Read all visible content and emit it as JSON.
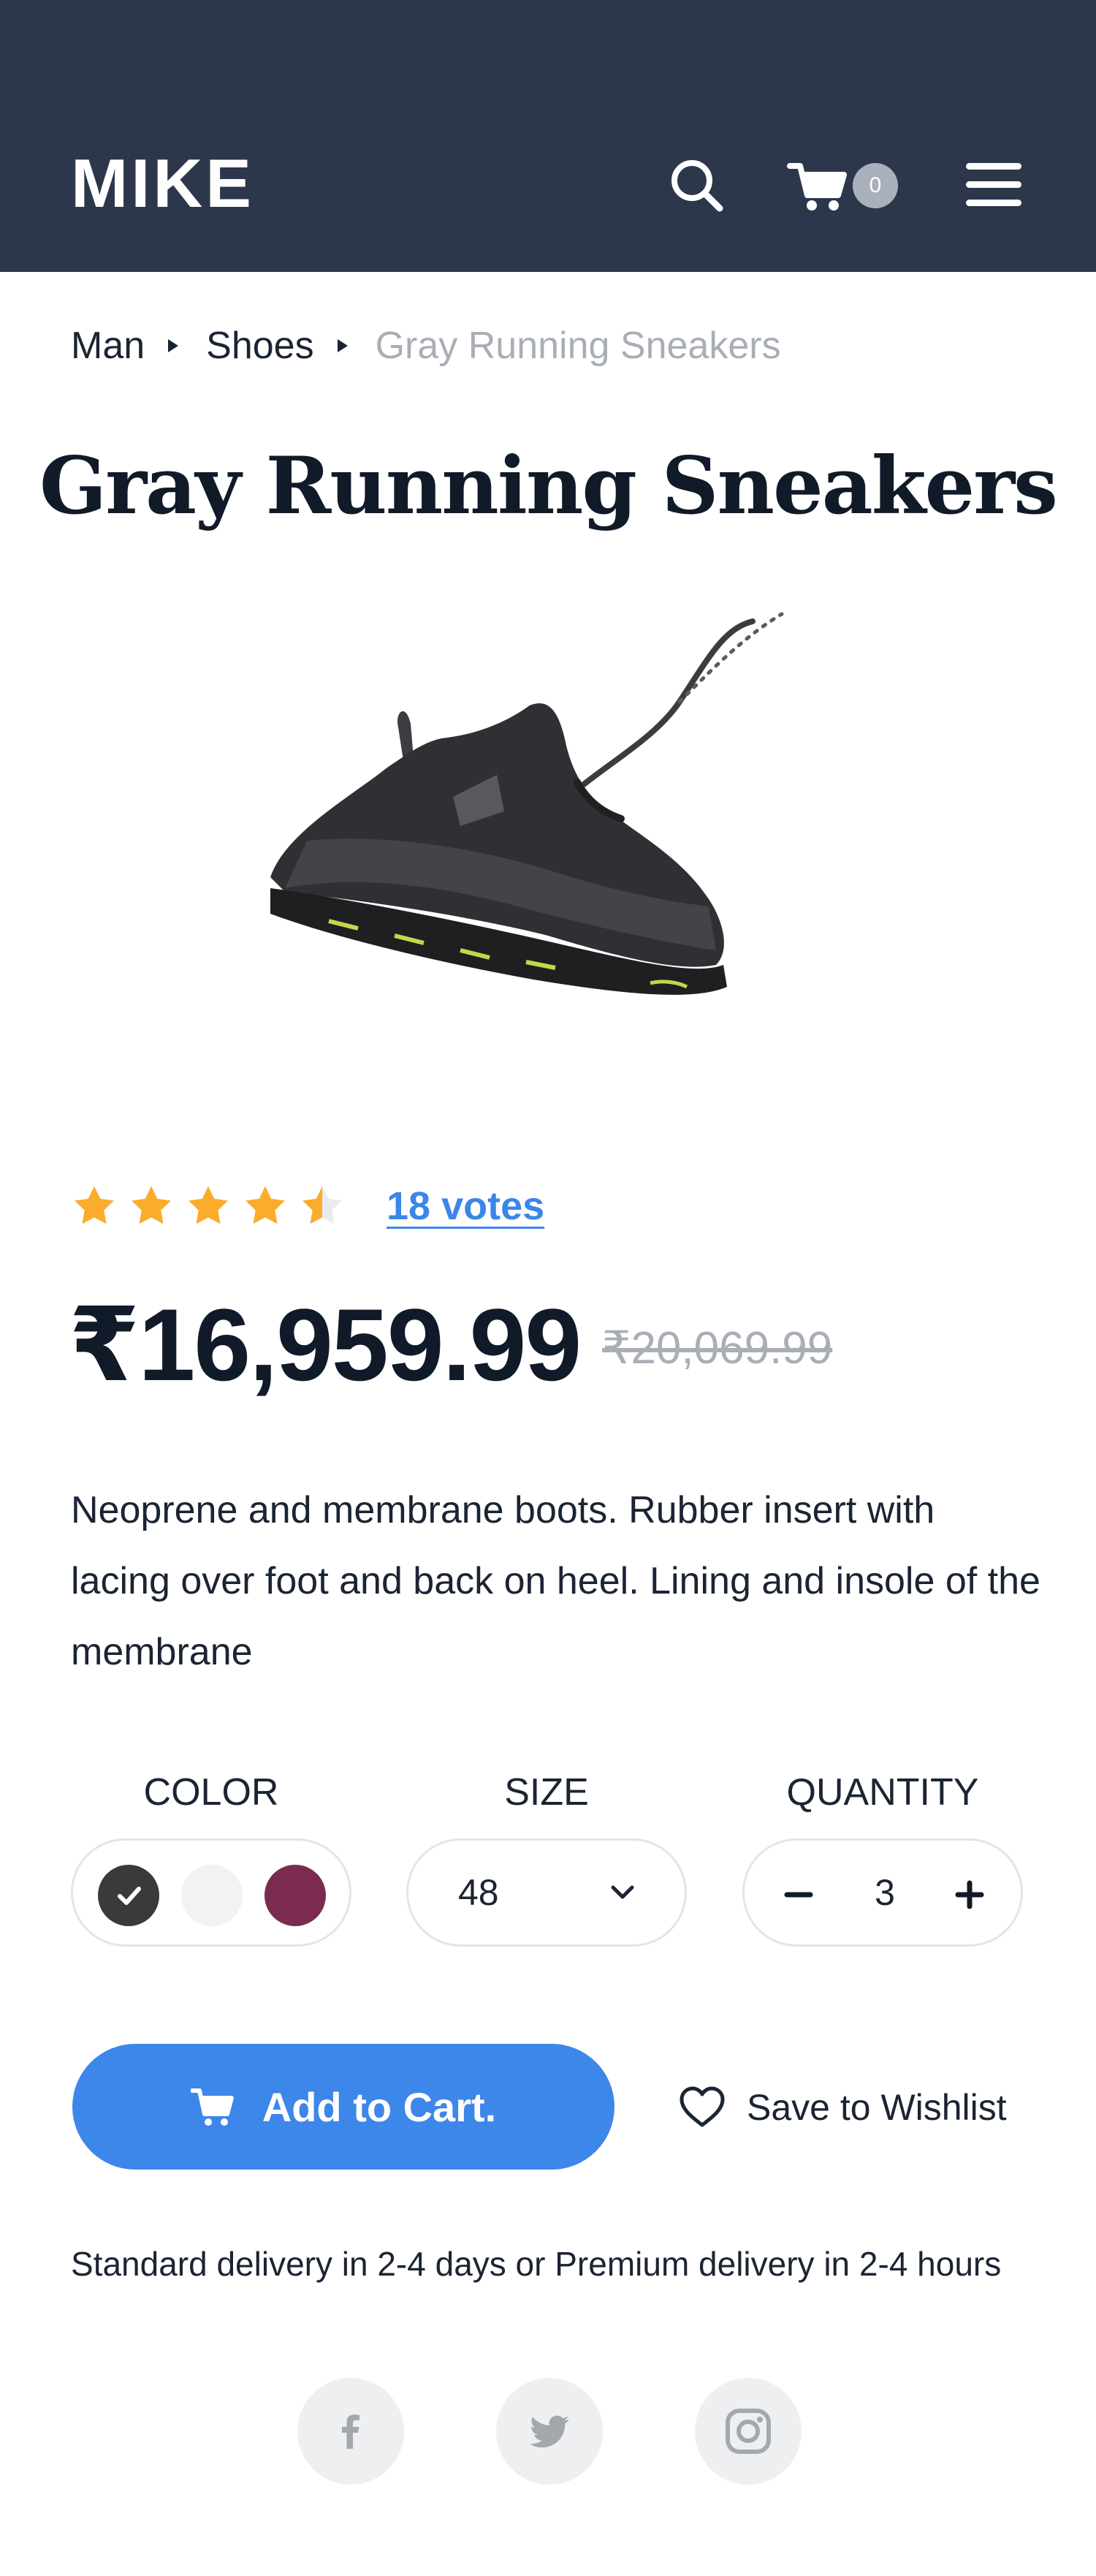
{
  "header": {
    "logo": "MIKE",
    "cart_count": "0",
    "background_color": "#2c374b",
    "icons": [
      "search-icon",
      "cart-icon",
      "hamburger-menu-icon"
    ]
  },
  "breadcrumb": {
    "items": [
      "Man",
      "Shoes"
    ],
    "current": "Gray Running Sneakers"
  },
  "product": {
    "title": "Gray Running Sneakers",
    "image": "gray-running-sneaker",
    "rating": 4.5,
    "rating_max": 5,
    "votes": "18 votes",
    "price": "₹16,959.99",
    "old_price": "₹20,069.99",
    "description": "Neoprene and membrane boots. Rubber insert with lacing over foot and back on heel. Lining and insole of the membrane"
  },
  "options": {
    "color_label": "COLOR",
    "colors": [
      "#3a3a3a",
      "#f1f2f4",
      "#7b2b50"
    ],
    "selected_color": "#3a3a3a",
    "size_label": "SIZE",
    "size_value": "48",
    "quantity_label": "QUANTITY",
    "quantity_value": "3"
  },
  "actions": {
    "add_to_cart": "Add to Cart.",
    "wishlist": "Save to Wishlist",
    "accent_color": "#3d86ea"
  },
  "delivery_text": "Standard delivery in 2-4 days or Premium delivery in 2-4 hours",
  "social": [
    "facebook-icon",
    "twitter-icon",
    "instagram-icon"
  ]
}
